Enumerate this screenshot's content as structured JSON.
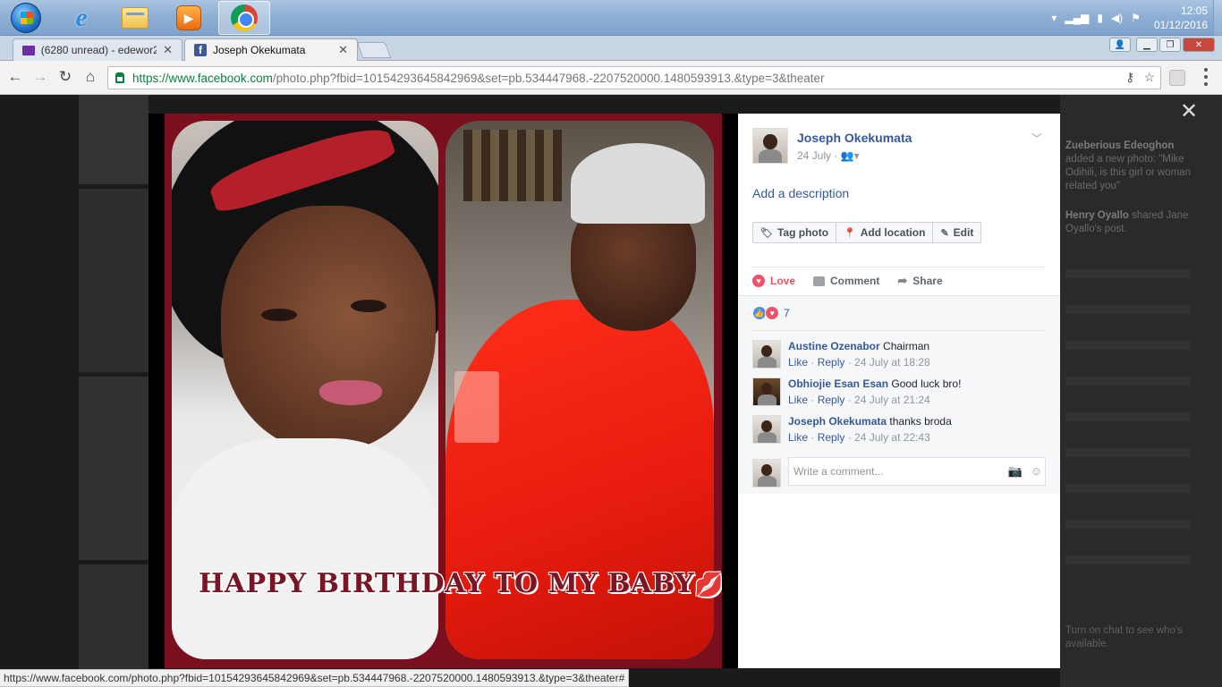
{
  "taskbar": {
    "apps": [
      "start",
      "internet-explorer",
      "file-explorer",
      "media-player",
      "chrome"
    ],
    "clock_time": "12:05",
    "clock_date": "01/12/2016"
  },
  "browser": {
    "tabs": [
      {
        "label": "(6280 unread) - edewor2",
        "icon": "mail-icon"
      },
      {
        "label": "Joseph Okekumata",
        "icon": "facebook-icon",
        "active": true
      }
    ],
    "url_host": "https://www.facebook.com",
    "url_rest": "/photo.php?fbid=10154293645842969&set=pb.534447968.-2207520000.1480593913.&type=3&theater",
    "status_url": "https://www.facebook.com/photo.php?fbid=10154293645842969&set=pb.534447968.-2207520000.1480593913.&type=3&theater#"
  },
  "photo": {
    "caption": "HAPPY BIRTHDAY TO MY BABY",
    "frame_color": "#7a0f1e"
  },
  "post": {
    "author": "Joseph Okekumata",
    "date": "24 July",
    "add_description": "Add a description",
    "buttons": {
      "tag": "Tag photo",
      "location": "Add location",
      "edit": "Edit"
    },
    "actions": {
      "love": "Love",
      "comment": "Comment",
      "share": "Share"
    },
    "reaction_count": "7",
    "comments": [
      {
        "name": "Austine Ozenabor",
        "text": "Chairman",
        "like": "Like",
        "reply": "Reply",
        "time": "24 July at 18:28"
      },
      {
        "name": "Obhiojie Esan Esan",
        "text": "Good luck bro!",
        "like": "Like",
        "reply": "Reply",
        "time": "24 July at 21:24"
      },
      {
        "name": "Joseph Okekumata",
        "text": "thanks broda",
        "like": "Like",
        "reply": "Reply",
        "time": "24 July at 22:43"
      }
    ],
    "comment_placeholder": "Write a comment..."
  },
  "background_sidebar": {
    "feed": [
      {
        "name": "Zueberious Edeoghon",
        "text": "added a new photo: \"Mike Odihili, is this girl or woman related you\""
      },
      {
        "name": "Henry Oyallo",
        "text": "shared Jane Oyallo's post."
      }
    ],
    "chat_hint": "Turn on chat to see who's available."
  },
  "colors": {
    "fb_blue": "#365899",
    "love_red": "#f25268"
  }
}
